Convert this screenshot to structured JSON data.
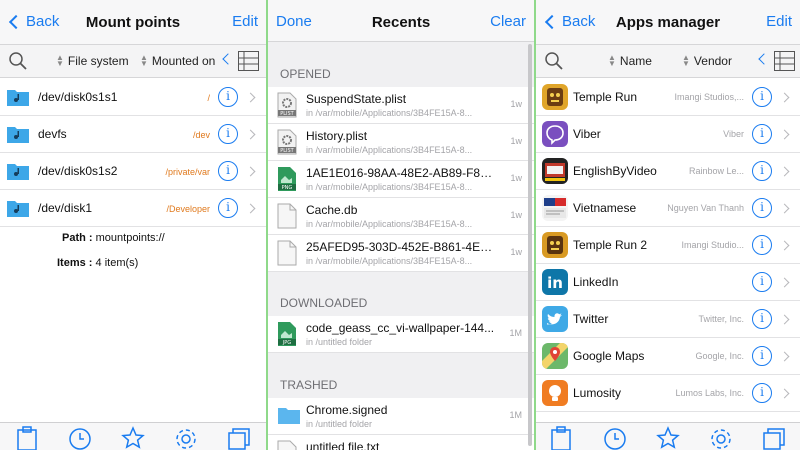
{
  "colors": {
    "accent": "#1a7cf0",
    "orange_text": "#e07a1e",
    "divider": "#8fd98a"
  },
  "mount_panel": {
    "back_label": "Back",
    "title": "Mount points",
    "edit_label": "Edit",
    "sort_file_system": "File system",
    "sort_mounted_on": "Mounted on",
    "rows": [
      {
        "name": "/dev/disk0s1s1",
        "mount": "/"
      },
      {
        "name": "devfs",
        "mount": "/dev"
      },
      {
        "name": "/dev/disk0s1s2",
        "mount": "/private/var"
      },
      {
        "name": "/dev/disk1",
        "mount": "/Developer"
      }
    ],
    "path_label": "Path :",
    "path_value": "mountpoints://",
    "items_label": "Items :",
    "items_value": "4 item(s)"
  },
  "recents_panel": {
    "done_label": "Done",
    "title": "Recents",
    "clear_label": "Clear",
    "sections": {
      "opened": "OPENED",
      "downloaded": "DOWNLOADED",
      "trashed": "TRASHED"
    },
    "opened": [
      {
        "name": "SuspendState.plist",
        "path": "in /var/mobile/Applications/3B4FE15A-8...",
        "size": "1w",
        "icon": "plist-file-icon"
      },
      {
        "name": "History.plist",
        "path": "in /var/mobile/Applications/3B4FE15A-8...",
        "size": "1w",
        "icon": "plist-file-icon"
      },
      {
        "name": "1AE1E016-98AA-48E2-AB89-F83...",
        "path": "in /var/mobile/Applications/3B4FE15A-8...",
        "size": "1w",
        "icon": "png-file-icon"
      },
      {
        "name": "Cache.db",
        "path": "in /var/mobile/Applications/3B4FE15A-8...",
        "size": "1w",
        "icon": "blank-file-icon"
      },
      {
        "name": "25AFED95-303D-452E-B861-4E3...",
        "path": "in /var/mobile/Applications/3B4FE15A-8...",
        "size": "1w",
        "icon": "blank-file-icon"
      }
    ],
    "downloaded": [
      {
        "name": "code_geass_cc_vi-wallpaper-144...",
        "path": "in /untitled folder",
        "size": "1M",
        "icon": "jpg-file-icon"
      }
    ],
    "trashed": [
      {
        "name": "Chrome.signed",
        "path": "in /untitled folder",
        "size": "1M",
        "icon": "folder-icon"
      },
      {
        "name": "untitled file.txt",
        "path": "",
        "size": "",
        "icon": "blank-file-icon"
      }
    ]
  },
  "apps_panel": {
    "back_label": "Back",
    "title": "Apps manager",
    "edit_label": "Edit",
    "sort_name": "Name",
    "sort_vendor": "Vendor",
    "apps": [
      {
        "name": "Temple Run",
        "vendor": "Imangi Studios,...",
        "icon": "temple-run-icon"
      },
      {
        "name": "Viber",
        "vendor": "Viber",
        "icon": "viber-icon"
      },
      {
        "name": "EnglishByVideo",
        "vendor": "Rainbow Le...",
        "icon": "englishbyvideo-icon"
      },
      {
        "name": "Vietnamese",
        "vendor": "Nguyen Van Thanh",
        "icon": "vietnamese-icon"
      },
      {
        "name": "Temple Run 2",
        "vendor": "Imangi Studio...",
        "icon": "temple-run-2-icon"
      },
      {
        "name": "LinkedIn",
        "vendor": "",
        "icon": "linkedin-icon"
      },
      {
        "name": "Twitter",
        "vendor": "Twitter, Inc.",
        "icon": "twitter-icon"
      },
      {
        "name": "Google Maps",
        "vendor": "Google, Inc.",
        "icon": "google-maps-icon"
      },
      {
        "name": "Lumosity",
        "vendor": "Lumos Labs, Inc.",
        "icon": "lumosity-icon"
      }
    ]
  }
}
